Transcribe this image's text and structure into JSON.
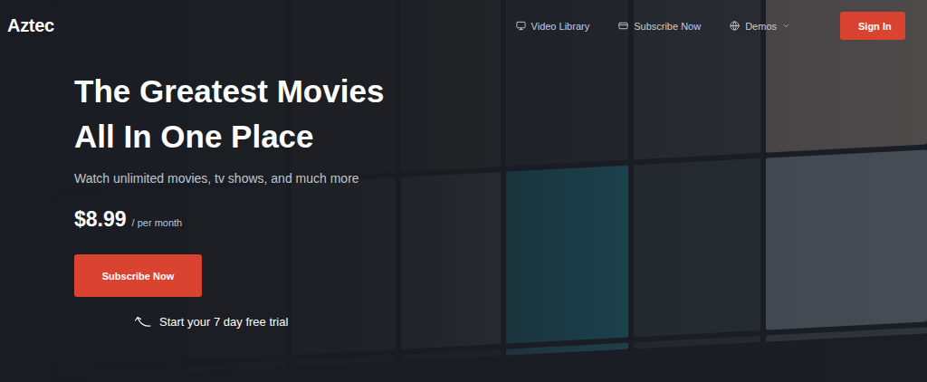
{
  "header": {
    "logo": "Aztec",
    "nav": [
      {
        "label": "Video Library",
        "dropdown": false
      },
      {
        "label": "Subscribe Now",
        "dropdown": false
      },
      {
        "label": "Demos",
        "dropdown": true
      }
    ],
    "sign_in": "Sign In"
  },
  "hero": {
    "title": [
      "The Greatest Movies",
      "All In One Place"
    ],
    "subtitle": "Watch unlimited movies, tv shows, and much more",
    "price": "$8.99",
    "period": "/ per month",
    "cta": "Subscribe Now",
    "trial_note": "Start your 7 day free trial"
  }
}
